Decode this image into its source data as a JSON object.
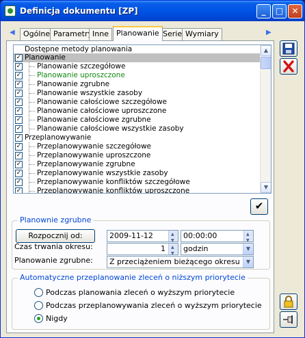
{
  "window": {
    "title": "Definicja dokumentu [ZP]"
  },
  "tabs": [
    {
      "label": "Ogólne",
      "active": false
    },
    {
      "label": "Parametry",
      "active": false
    },
    {
      "label": "Inne",
      "active": false
    },
    {
      "label": "Planowanie",
      "active": true
    },
    {
      "label": "Serie",
      "active": false
    },
    {
      "label": "Wymiary",
      "active": false
    }
  ],
  "methods": {
    "header": "Dostępne metody planowania",
    "rows": [
      {
        "label": "Planowanie",
        "checked": true,
        "level": 0,
        "selected": true
      },
      {
        "label": "Planowanie szczegółowe",
        "checked": true,
        "level": 1
      },
      {
        "label": "Planowanie uproszczone",
        "checked": true,
        "level": 1,
        "highlight": "#118811"
      },
      {
        "label": "Planowanie zgrubne",
        "checked": true,
        "level": 1
      },
      {
        "label": "Planowanie wszystkie zasoby",
        "checked": true,
        "level": 1
      },
      {
        "label": "Planowanie całościowe szczegółowe",
        "checked": true,
        "level": 1
      },
      {
        "label": "Planowanie całościowe uproszczone",
        "checked": true,
        "level": 1
      },
      {
        "label": "Planowanie całościowe zgrubne",
        "checked": true,
        "level": 1
      },
      {
        "label": "Planowanie całościowe wszystkie zasoby",
        "checked": true,
        "level": 1
      },
      {
        "label": "Przeplanowywanie",
        "checked": true,
        "level": 0
      },
      {
        "label": "Przeplanowywanie szczegółowe",
        "checked": true,
        "level": 1
      },
      {
        "label": "Przeplanowywanie uproszczone",
        "checked": true,
        "level": 1
      },
      {
        "label": "Przeplanowywanie zgrubne",
        "checked": true,
        "level": 1
      },
      {
        "label": "Przeplanowywanie wszystkie zasoby",
        "checked": true,
        "level": 1
      },
      {
        "label": "Przeplanowywanie konfliktów szczegółowe",
        "checked": true,
        "level": 1
      },
      {
        "label": "Przeplanowywanie konfliktów uproszczone",
        "checked": true,
        "level": 1
      }
    ]
  },
  "rough": {
    "title": "Planownie zgrubne",
    "start_button": "Rozpocznij od:",
    "start_date": "2009-11-12",
    "start_time": "00:00:00",
    "duration_label": "Czas trwania okresu:",
    "duration_value": "1",
    "duration_unit": "godzin",
    "mode_label": "Planowanie zgrubne:",
    "mode_value": "Z przeciążeniem bieżącego okresu"
  },
  "auto": {
    "title": "Automatyczne przeplanowanie zleceń o niższym priorytecie",
    "options": [
      {
        "label": "Podczas planowania zleceń o wyższym priorytecie",
        "selected": false
      },
      {
        "label": "Podczas przeplanowywania zleceń o wyższym priorytecie",
        "selected": false
      },
      {
        "label": "Nigdy",
        "selected": true
      }
    ]
  },
  "icons": {
    "save": "save-icon",
    "delete": "delete-icon",
    "confirm": "checkmark-icon",
    "lock": "lock-icon",
    "pin": "pin-icon"
  }
}
